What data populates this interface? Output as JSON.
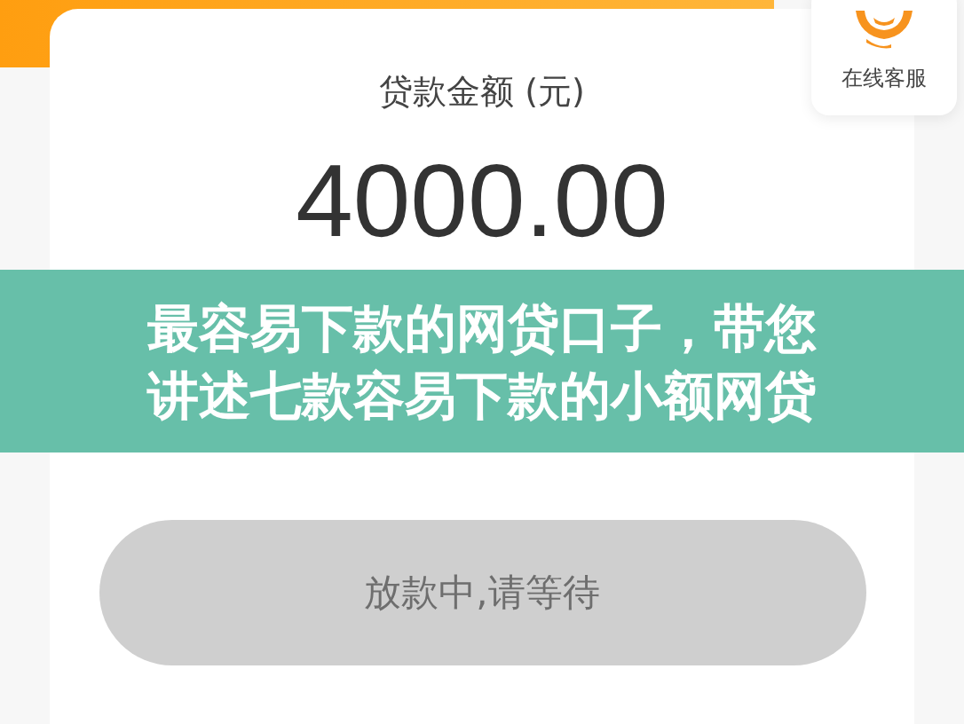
{
  "loan": {
    "label": "贷款金额 (元)",
    "amount": "4000.00"
  },
  "support": {
    "label": "在线客服"
  },
  "banner": {
    "lines": [
      "最容易下款的网贷口子，带您",
      "讲述七款容易下款的小额网贷"
    ]
  },
  "status_button": {
    "label": "放款中,请等待",
    "disabled": true
  }
}
